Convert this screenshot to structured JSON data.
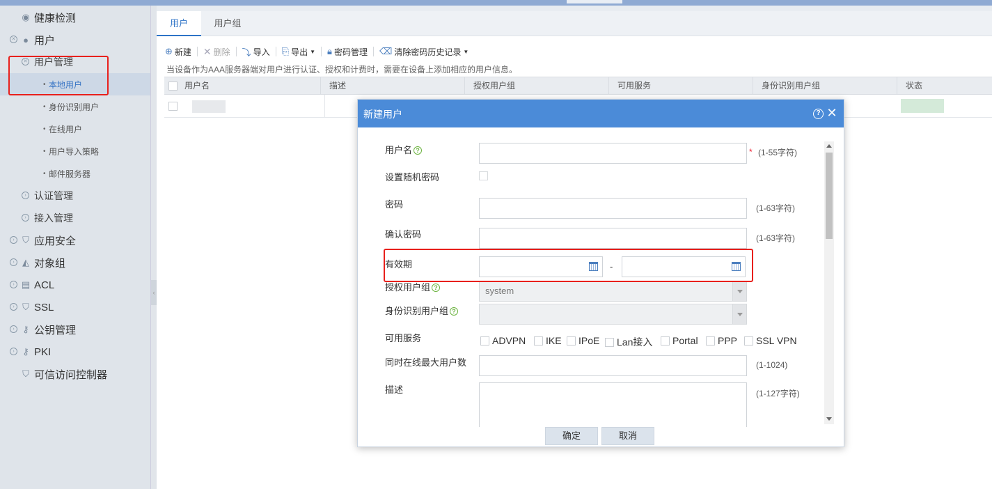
{
  "sidebar": {
    "items": [
      {
        "label": "健康检测",
        "level": 1,
        "icon": "health-icon"
      },
      {
        "label": "用户",
        "level": 1,
        "icon": "user-icon"
      },
      {
        "label": "用户管理",
        "level": 2
      },
      {
        "label": "本地用户",
        "level": 3,
        "active": true
      },
      {
        "label": "身份识别用户",
        "level": 3
      },
      {
        "label": "在线用户",
        "level": 3
      },
      {
        "label": "用户导入策略",
        "level": 3
      },
      {
        "label": "邮件服务器",
        "level": 3
      },
      {
        "label": "认证管理",
        "level": 2
      },
      {
        "label": "接入管理",
        "level": 2
      },
      {
        "label": "应用安全",
        "level": 1,
        "icon": "shield-icon"
      },
      {
        "label": "对象组",
        "level": 1,
        "icon": "objects-icon"
      },
      {
        "label": "ACL",
        "level": 1,
        "icon": "acl-icon"
      },
      {
        "label": "SSL",
        "level": 1,
        "icon": "shield-icon"
      },
      {
        "label": "公钥管理",
        "level": 1,
        "icon": "key-icon"
      },
      {
        "label": "PKI",
        "level": 1,
        "icon": "key-icon"
      },
      {
        "label": "可信访问控制器",
        "level": 1,
        "icon": "shield-icon"
      }
    ]
  },
  "tabs": [
    "用户",
    "用户组"
  ],
  "toolbar": {
    "new": "新建",
    "delete": "删除",
    "import": "导入",
    "export": "导出",
    "password_mgmt": "密码管理",
    "clear_history": "清除密码历史记录"
  },
  "notice": "当设备作为AAA服务器端对用户进行认证、授权和计费时，需要在设备上添加相应的用户信息。",
  "grid": {
    "columns": [
      "用户名",
      "描述",
      "授权用户组",
      "可用服务",
      "身份识别用户组",
      "状态"
    ]
  },
  "modal": {
    "title": "新建用户",
    "fields": {
      "username": {
        "label": "用户名",
        "hint": "(1-55字符)",
        "required_mark": "*"
      },
      "random_password": {
        "label": "设置随机密码"
      },
      "password": {
        "label": "密码",
        "hint": "(1-63字符)"
      },
      "confirm_password": {
        "label": "确认密码",
        "hint": "(1-63字符)"
      },
      "validity": {
        "label": "有效期",
        "separator": "-"
      },
      "auth_group": {
        "label": "授权用户组",
        "value": "system"
      },
      "identity_group": {
        "label": "身份识别用户组"
      },
      "services": {
        "label": "可用服务",
        "options": [
          "ADVPN",
          "IKE",
          "IPoE",
          "Lan接入",
          "Portal",
          "PPP",
          "SSL VPN"
        ]
      },
      "max_online": {
        "label": "同时在线最大用户数",
        "hint": "(1-1024)"
      },
      "description": {
        "label": "描述",
        "hint": "(1-127字符)"
      }
    },
    "ok": "确定",
    "cancel": "取消"
  },
  "colors": {
    "accent": "#4b8bd8",
    "highlight_box": "#e8201c",
    "sidebar_bg": "#dfe4ea"
  }
}
